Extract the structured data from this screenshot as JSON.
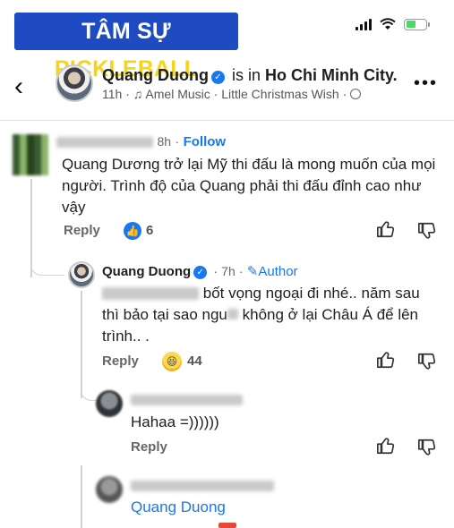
{
  "brand": {
    "part1": "TÂM SỰ ",
    "part2": "PICKLEBALL"
  },
  "post": {
    "author": "Quang Duong",
    "location_prefix": "is in",
    "location": "Ho Chi Minh City.",
    "time": "11h",
    "music": "Amel Music",
    "song": "Little Christmas Wish"
  },
  "comment1": {
    "time": "8h",
    "follow": "Follow",
    "text": "Quang Dương trở lại Mỹ thi đấu là mong muốn của mọi người. Trình độ của Quang phải thi đấu đỉnh cao như vậy",
    "reply": "Reply",
    "likes": "6"
  },
  "reply1": {
    "author": "Quang Duong",
    "time": "7h",
    "author_badge": "Author",
    "text_part1": "bốt vọng ngoại đi nhé.. năm sau",
    "text_part2": "thì bảo tại sao ngu",
    "text_part3": "không ở lại Châu Á để lên trình.. .",
    "reply": "Reply",
    "reactions": "44"
  },
  "reply2": {
    "text": "Hahaa =))))))",
    "reply": "Reply"
  },
  "reply3": {
    "author_preview": "Quang Duong"
  },
  "colors": {
    "accent": "#1877f2",
    "brand_bg": "#1f4bc2",
    "brand_highlight": "#f5d419"
  }
}
